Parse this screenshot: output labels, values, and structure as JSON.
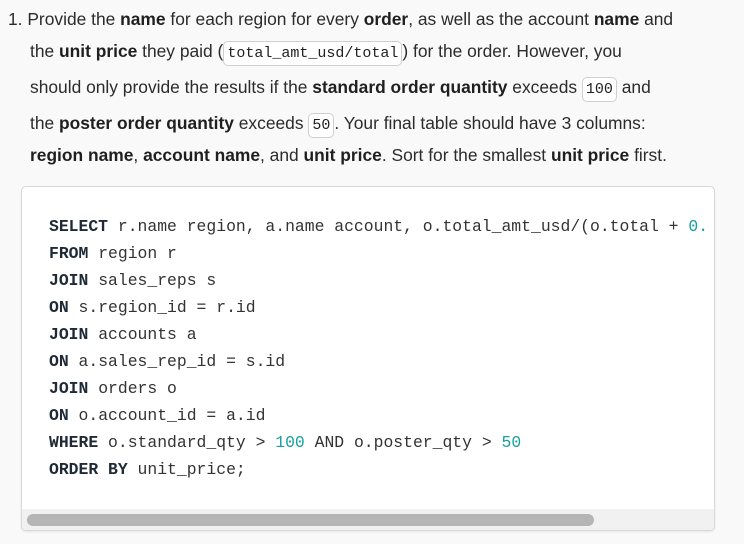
{
  "question": {
    "lines": [
      [
        {
          "t": "1. Provide the "
        },
        {
          "t": "name",
          "s": "b"
        },
        {
          "t": " for each region for every "
        },
        {
          "t": "order",
          "s": "b"
        },
        {
          "t": ", as well as the account "
        },
        {
          "t": "name",
          "s": "b"
        },
        {
          "t": " and"
        }
      ],
      [
        {
          "t": "the "
        },
        {
          "t": "unit price",
          "s": "b"
        },
        {
          "t": " they paid ("
        },
        {
          "t": "total_amt_usd/total",
          "s": "c"
        },
        {
          "t": ") for the order. However, you"
        }
      ],
      [
        {
          "t": "should only provide the results if the "
        },
        {
          "t": "standard order quantity",
          "s": "b"
        },
        {
          "t": " exceeds "
        },
        {
          "t": "100",
          "s": "c"
        },
        {
          "t": " and"
        }
      ],
      [
        {
          "t": "the "
        },
        {
          "t": "poster order quantity",
          "s": "b"
        },
        {
          "t": " exceeds "
        },
        {
          "t": "50",
          "s": "c"
        },
        {
          "t": ". Your final table should have 3 columns:"
        }
      ],
      [
        {
          "t": "region name",
          "s": "b"
        },
        {
          "t": ", "
        },
        {
          "t": "account name",
          "s": "b"
        },
        {
          "t": ", and "
        },
        {
          "t": "unit price",
          "s": "b"
        },
        {
          "t": ". Sort for the smallest "
        },
        {
          "t": "unit price",
          "s": "b"
        },
        {
          "t": " first."
        }
      ]
    ]
  },
  "code": {
    "lines": [
      [
        {
          "t": "SELECT",
          "k": "kw"
        },
        {
          "t": " r.name region, a.name account, o.total_amt_usd/(o.total + "
        },
        {
          "t": "0.",
          "k": "num"
        }
      ],
      [
        {
          "t": "FROM",
          "k": "kw"
        },
        {
          "t": " region r"
        }
      ],
      [
        {
          "t": "JOIN",
          "k": "kw"
        },
        {
          "t": " sales_reps s"
        }
      ],
      [
        {
          "t": "ON",
          "k": "kw"
        },
        {
          "t": " s.region_id = r.id"
        }
      ],
      [
        {
          "t": "JOIN",
          "k": "kw"
        },
        {
          "t": " accounts a"
        }
      ],
      [
        {
          "t": "ON",
          "k": "kw"
        },
        {
          "t": " a.sales_rep_id = s.id"
        }
      ],
      [
        {
          "t": "JOIN",
          "k": "kw"
        },
        {
          "t": " orders o"
        }
      ],
      [
        {
          "t": "ON",
          "k": "kw"
        },
        {
          "t": " o.account_id = a.id"
        }
      ],
      [
        {
          "t": "WHERE",
          "k": "kw"
        },
        {
          "t": " o.standard_qty > "
        },
        {
          "t": "100",
          "k": "num"
        },
        {
          "t": " AND o.poster_qty > "
        },
        {
          "t": "50",
          "k": "num"
        }
      ],
      [
        {
          "t": "ORDER BY",
          "k": "kw"
        },
        {
          "t": " unit_price;"
        }
      ]
    ]
  },
  "colors": {
    "keyword": "#1f2a36",
    "number": "#18a0a0",
    "background": "#f9f9f9"
  }
}
